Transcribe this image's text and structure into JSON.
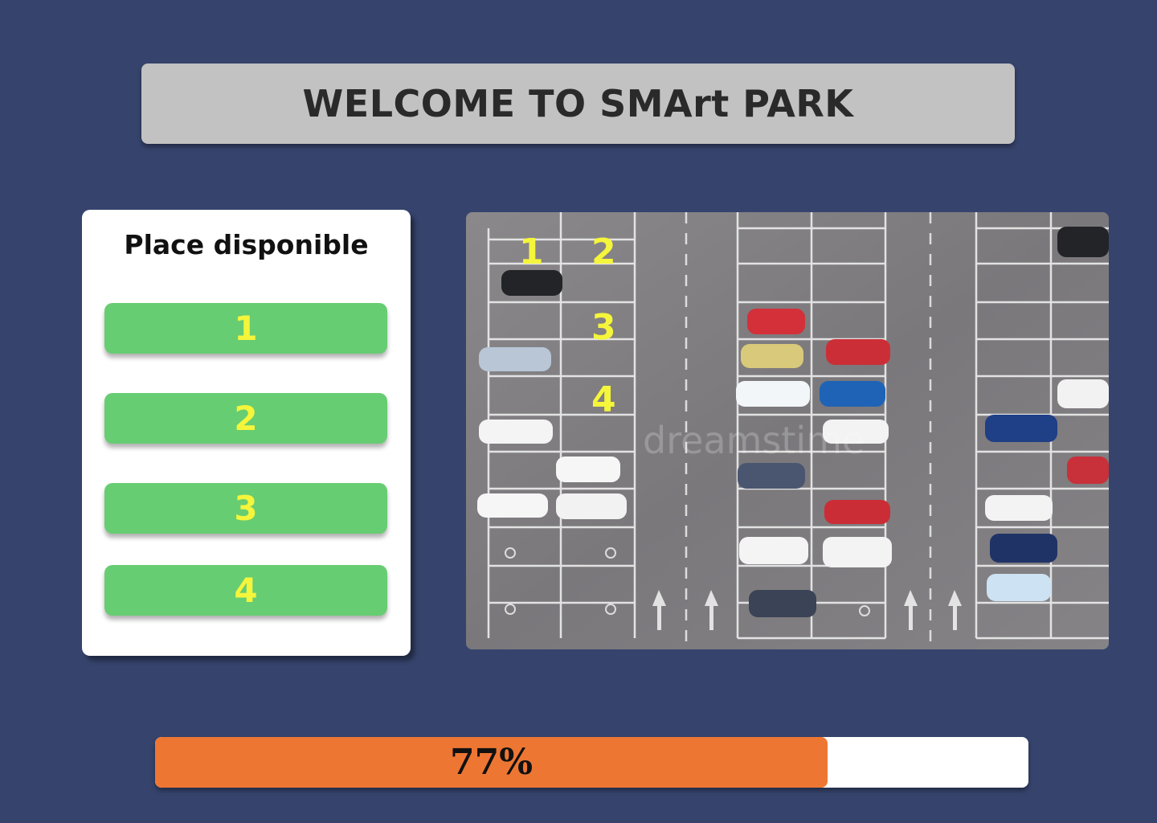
{
  "header": {
    "title": "WELCOME TO SMArt PARK"
  },
  "available_panel": {
    "title": "Place disponible",
    "slots": [
      {
        "label": "1"
      },
      {
        "label": "2"
      },
      {
        "label": "3"
      },
      {
        "label": "4"
      }
    ],
    "slot_color": "#67cd72",
    "slot_text_color": "#f5f53b"
  },
  "parking_image": {
    "spot_labels": [
      "1",
      "2",
      "3",
      "4"
    ],
    "watermark": "dreamstime",
    "label_color": "#f5f53b"
  },
  "occupancy": {
    "percent": 77,
    "label": "77%",
    "fill_color": "#ee7633"
  },
  "colors": {
    "background": "#36446d",
    "header_bg": "#c2c2c2"
  }
}
